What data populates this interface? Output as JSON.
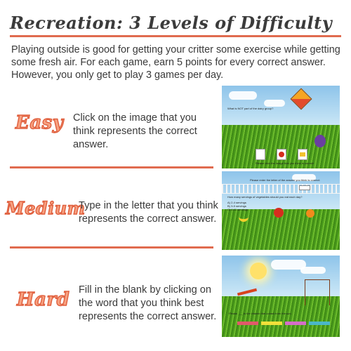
{
  "title": "Recreation: 3 Levels of Difficulty",
  "intro": "Playing outside is good for getting your critter some exercise while getting some fresh air. For each game, earn 5 points for every correct answer. However, you only get to play 3 games per day.",
  "levels": [
    {
      "name": "Easy",
      "instruction": "Click on the image that you think represents the correct answer."
    },
    {
      "name": "Medium",
      "instruction": "Type in the letter that you think represents the correct answer."
    },
    {
      "name": "Hard",
      "instruction": "Fill in the blank by clicking on the word that you think best represents the correct answer."
    }
  ],
  "previews": [
    {
      "question": "What is NOT part of the dairy group?",
      "footer": "Please click the image that you think is correct!"
    },
    {
      "header": "Please enter the letter of the answer you think is correct:",
      "question": "How many servings of vegetables should you eat each day?",
      "options": [
        "A) 2-4 servings",
        "B) 3-5 servings",
        "C) 6-11 servings"
      ]
    },
    {
      "question": "Please ___ is the vitamin that comes from the sun."
    }
  ],
  "colors": {
    "accent": "#e06b4f",
    "level_fill": "#f7a07f"
  }
}
